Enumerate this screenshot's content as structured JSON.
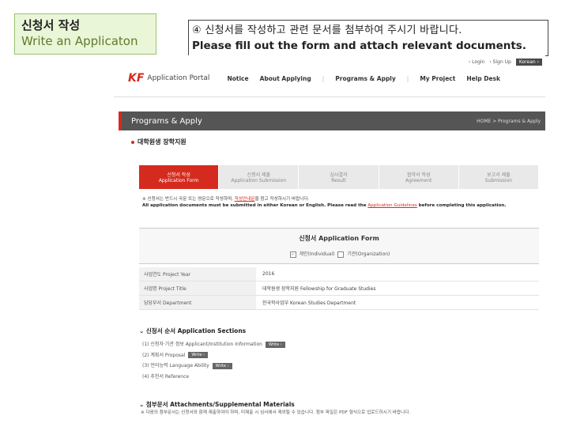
{
  "step": {
    "title_ko": "신청서 작성",
    "title_en": "Write an Applicaton"
  },
  "instruction": {
    "ko": "④ 신청서를 작성하고 관련 문서를 첨부하여 주시기 바랍니다.",
    "en": "Please fill out the form and attach relevant documents."
  },
  "portal": {
    "top_links": {
      "login": "Login",
      "signup": "Sign Up",
      "language": "Korean"
    },
    "logo_mark": "KF",
    "logo_text": "Application Portal",
    "nav": [
      "Notice",
      "About Applying",
      "Programs & Apply",
      "My Project",
      "Help Desk"
    ],
    "page_title": "Programs & Apply",
    "breadcrumb": "HOME > Programs & Apply",
    "program_title": "대학원생 장학지원",
    "tabs": [
      {
        "ko": "신청서 작성",
        "en": "Application Form"
      },
      {
        "ko": "신청서 제출",
        "en": "Application Submission"
      },
      {
        "ko": "심사결과",
        "en": "Result"
      },
      {
        "ko": "협약서 작성",
        "en": "Agreement"
      },
      {
        "ko": "보고서 제출",
        "en": "Submission"
      }
    ],
    "notice": {
      "ko_pre": "※ 신청서는 반드시 국문 또는 영문으로 작성하며,",
      "ko_link": "작성안내문",
      "ko_post": "을 참고 작성하시기 바랍니다.",
      "en_pre": "All application documents must be submitted in either Korean or English. Please read the",
      "en_link": "Application Guidelines",
      "en_post": "before completing this application."
    },
    "form": {
      "title_ko": "신청서",
      "title_en": "Application Form",
      "type_individual": "개인(Individual)",
      "type_organization": "기관(Organization)"
    },
    "rows": [
      {
        "label": "사업연도 Project Year",
        "value": "2016"
      },
      {
        "label": "사업명 Project Title",
        "value": "대학원생 장학지원 Fellowship for Graduate Studies"
      },
      {
        "label": "담당부서 Department",
        "value": "한국학사업부 Korean Studies Department"
      }
    ],
    "sections": {
      "title": "신청서 순서 Application Sections",
      "items": [
        {
          "label": "(1) 신청자·기관 정보 Applicant/Institution Information",
          "button": "Write"
        },
        {
          "label": "(2) 계획서 Proposal",
          "button": "Write"
        },
        {
          "label": "(3) 언어능력 Language Ability",
          "button": "Write"
        },
        {
          "label": "(4) 추천서 Reference",
          "button": ""
        }
      ]
    },
    "attachments": {
      "title": "첨부문서 Attachments/Supplemental Materials",
      "text": "※ 다음의 첨부문서는 신청서와 함께 제출하여야 하며, 미제출 시 심사에서 제외될 수 있습니다. 첨부 파일은 PDF 형식으로 업로드하시기 바랍니다."
    }
  }
}
